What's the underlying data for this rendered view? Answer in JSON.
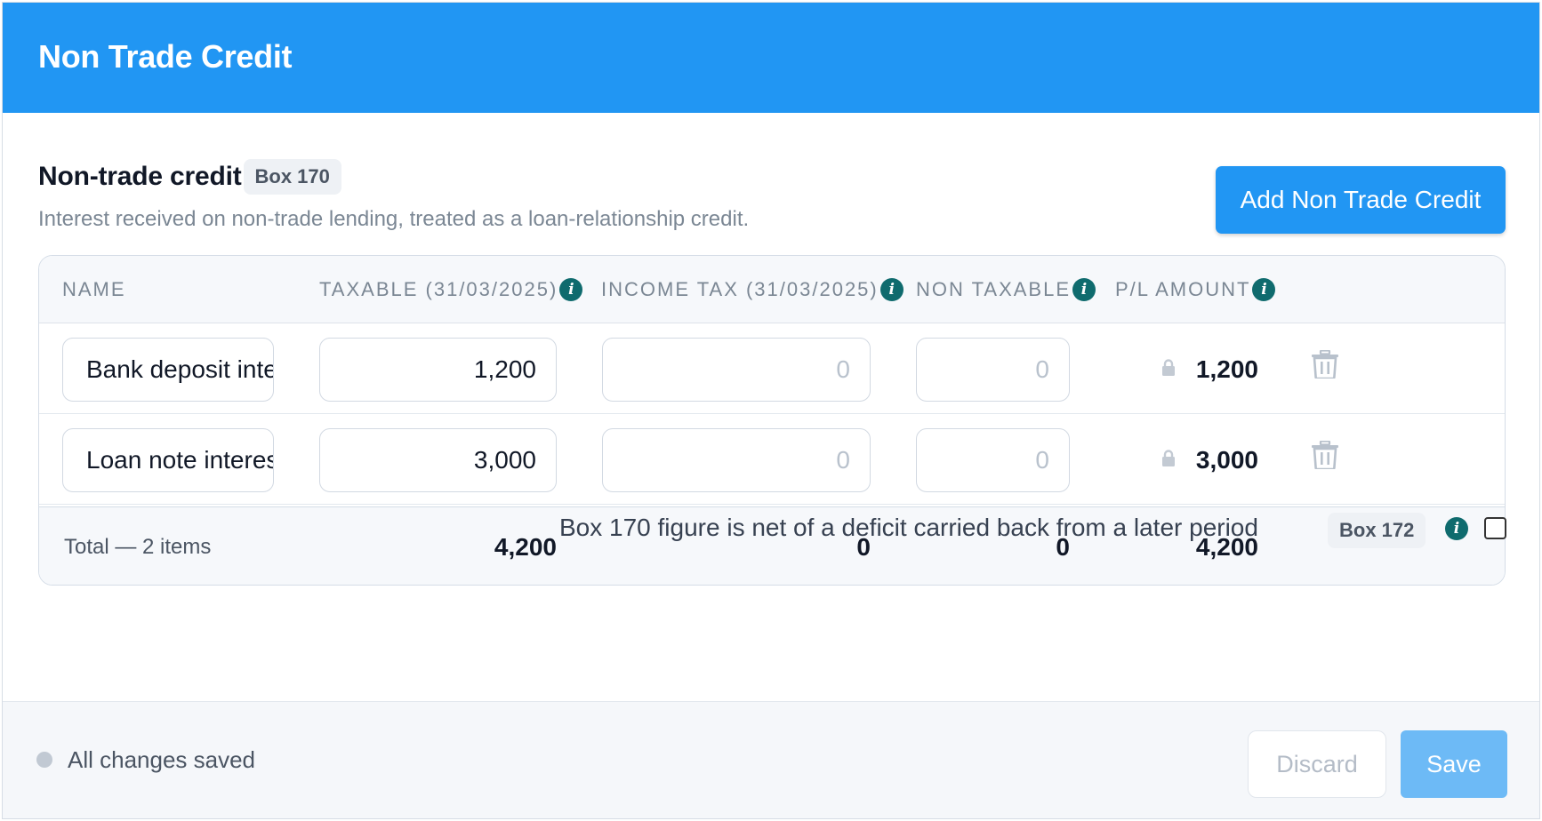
{
  "header": {
    "title": "Non Trade Credit"
  },
  "section": {
    "title": "Non-trade credit",
    "badge": "Box 170",
    "subtitle": "Interest received on non-trade lending, treated as a loan-relationship credit.",
    "add_button": "Add Non Trade Credit"
  },
  "table": {
    "columns": {
      "name": "NAME",
      "taxable": "TAXABLE (31/03/2025)",
      "income_tax": "INCOME TAX (31/03/2025)",
      "non_taxable": "NON TAXABLE",
      "pl_amount": "P/L AMOUNT"
    },
    "rows": [
      {
        "name": "Bank deposit interest",
        "taxable": "1,200",
        "income_tax": "0",
        "non_taxable": "0",
        "pl_amount": "1,200"
      },
      {
        "name": "Loan note interest",
        "taxable": "3,000",
        "income_tax": "0",
        "non_taxable": "0",
        "pl_amount": "3,000"
      }
    ],
    "totals": {
      "label": "Total — 2 items",
      "taxable": "4,200",
      "income_tax": "0",
      "non_taxable": "0",
      "pl_amount": "4,200"
    }
  },
  "note": {
    "text": "Box 170 figure is net of a deficit carried back from a later period",
    "badge": "Box 172",
    "checked": false
  },
  "footer": {
    "status": "All changes saved",
    "discard_label": "Discard",
    "save_label": "Save"
  },
  "colors": {
    "brand": "#2196f3",
    "info_icon": "#0f6b6e",
    "save_disabled": "#6dbaf6"
  },
  "icons": [
    "info-icon",
    "lock-icon",
    "trash-icon",
    "status-dot-icon"
  ]
}
